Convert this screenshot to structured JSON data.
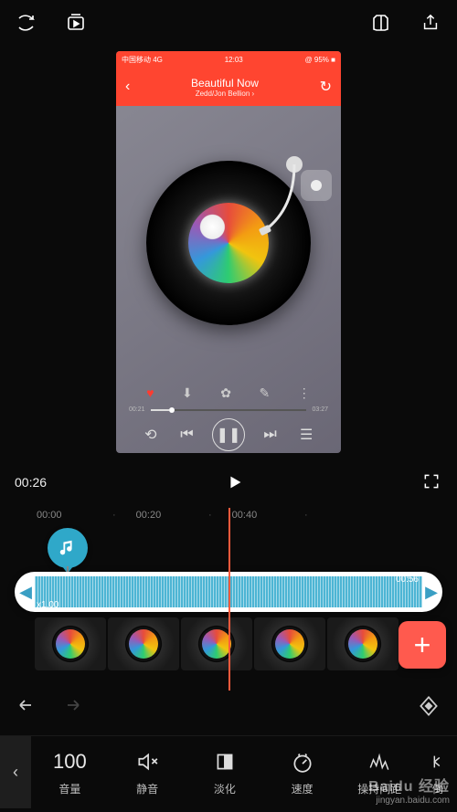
{
  "topToolbar": {
    "nav": "nav-icon",
    "play": "play-box-icon",
    "stack": "card-stack-icon",
    "share": "share-icon"
  },
  "phone": {
    "status": {
      "carrier": "中国移动 4G",
      "time": "12:03",
      "battery": "95%"
    },
    "title": "Beautiful Now",
    "artist": "Zedd/Jon Bellion",
    "progress": {
      "current": "00:21",
      "total": "03:27"
    }
  },
  "playback": {
    "time": "00:26"
  },
  "ruler": {
    "t0": "00:00",
    "t1": "00:20",
    "t2": "00:40"
  },
  "clip": {
    "duration": "00:56",
    "speed": "x1.00"
  },
  "tools": {
    "volume": {
      "value": "100",
      "label": "音量"
    },
    "mute": {
      "label": "静音"
    },
    "fade": {
      "label": "淡化"
    },
    "speed": {
      "label": "速度"
    },
    "adjust": {
      "label": "操持间距"
    },
    "reverse": {
      "label": "倒"
    }
  },
  "watermark": {
    "brand": "Baidu 经验",
    "url": "jingyan.baidu.com"
  }
}
